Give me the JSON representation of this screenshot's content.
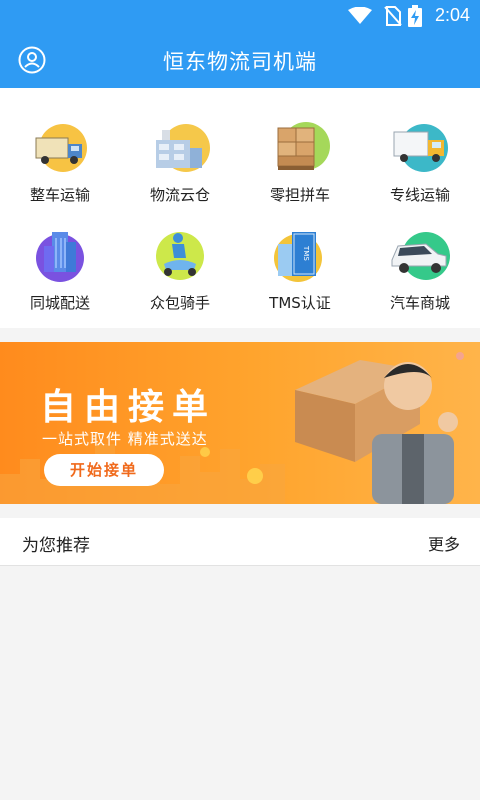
{
  "status_bar": {
    "time": "2:04",
    "icons": [
      "wifi-icon",
      "no-sim-icon",
      "battery-charging-icon"
    ]
  },
  "header": {
    "title": "恒东物流司机端",
    "user_icon": "user-circle-icon"
  },
  "services": [
    {
      "label": "整车运输",
      "icon": "truck-icon"
    },
    {
      "label": "物流云仓",
      "icon": "warehouse-icon"
    },
    {
      "label": "零担拼车",
      "icon": "cargo-boxes-icon"
    },
    {
      "label": "专线运输",
      "icon": "box-truck-icon"
    },
    {
      "label": "同城配送",
      "icon": "city-building-icon"
    },
    {
      "label": "众包骑手",
      "icon": "scooter-rider-icon"
    },
    {
      "label": "TMS认证",
      "icon": "tms-book-icon"
    },
    {
      "label": "汽车商城",
      "icon": "car-icon"
    }
  ],
  "banner": {
    "title": "自由接单",
    "subtitle": "一站式取件 精准式送达",
    "button_label": "开始接单",
    "colors": {
      "start": "#ff8b1d",
      "end": "#ffb44a"
    }
  },
  "recommend": {
    "title": "为您推荐",
    "more_label": "更多"
  },
  "colors": {
    "primary": "#2f9bf3",
    "background": "#f4f4f4"
  }
}
